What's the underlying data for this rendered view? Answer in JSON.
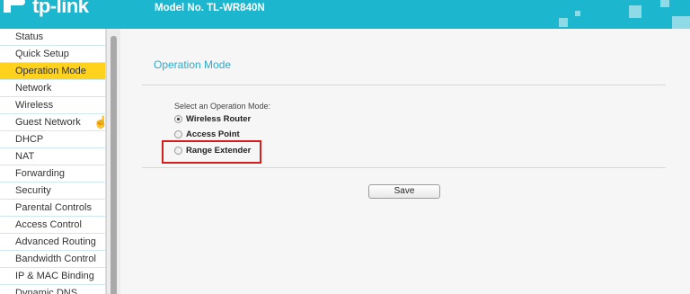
{
  "header": {
    "logo_text": "tp-link",
    "model": "Model No. TL-WR840N"
  },
  "sidebar": {
    "items": [
      {
        "label": "Status"
      },
      {
        "label": "Quick Setup"
      },
      {
        "label": "Operation Mode",
        "active": true
      },
      {
        "label": "Network"
      },
      {
        "label": "Wireless"
      },
      {
        "label": "Guest Network"
      },
      {
        "label": "DHCP"
      },
      {
        "label": "NAT"
      },
      {
        "label": "Forwarding"
      },
      {
        "label": "Security"
      },
      {
        "label": "Parental Controls"
      },
      {
        "label": "Access Control"
      },
      {
        "label": "Advanced Routing"
      },
      {
        "label": "Bandwidth Control"
      },
      {
        "label": "IP & MAC Binding"
      },
      {
        "label": "Dynamic DNS"
      }
    ]
  },
  "main": {
    "title": "Operation Mode",
    "prompt": "Select an Operation Mode:",
    "options": [
      {
        "label": "Wireless Router",
        "selected": true
      },
      {
        "label": "Access Point",
        "selected": false
      },
      {
        "label": "Range Extender",
        "selected": false
      }
    ],
    "save_label": "Save"
  },
  "colors": {
    "header_bg": "#1cb7cf",
    "active_menu_bg": "#ffd21e",
    "title_color": "#2fa9c9",
    "highlight_border": "#d51f1f"
  },
  "icons": {
    "logo": "tp-link-logo-icon",
    "cursor": "hand-cursor-icon"
  }
}
